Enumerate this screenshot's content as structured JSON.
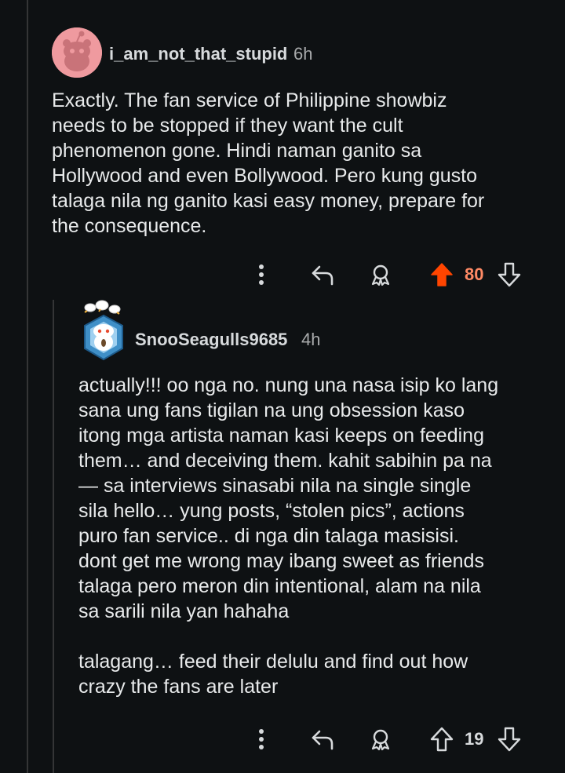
{
  "comments": [
    {
      "username": "i_am_not_that_stupid",
      "time": "6h",
      "avatar_icon": "reddit-snoo-pink-avatar",
      "body": "Exactly. The fan service of Philippine showbiz\nneeds to be stopped if they want the cult\nphenomenon gone. Hindi naman ganito sa\nHollywood and even Bollywood. Pero kung gusto\ntalaga nila ng ganito kasi easy money, prepare for\nthe consequence.",
      "score": "80",
      "upvoted": true
    },
    {
      "username": "SnooSeagulls9685",
      "time": "4h",
      "avatar_icon": "snoo-seagull-hexagon-avatar",
      "body": "actually!!! oo nga no. nung una nasa isip ko lang\nsana ung fans tigilan na ung obsession kaso\nitong mga artista naman kasi keeps on feeding\nthem… and deceiving them. kahit sabihin pa na\n— sa interviews sinasabi nila na single single\nsila hello… yung posts, “stolen pics”, actions\npuro fan service.. di nga din talaga masisisi.\ndont get me wrong may ibang sweet as friends\ntalaga pero meron din intentional, alam na nila\nsa sarili nila yan hahaha\n\ntalagang… feed their delulu and find out how\ncrazy the fans are later",
      "score": "19",
      "upvoted": false
    }
  ],
  "colors": {
    "background": "#0e1113",
    "upvote_active": "#ff4500",
    "score_active": "#ff8a65",
    "icon": "#d7dadc",
    "thread_line": "#343536"
  }
}
